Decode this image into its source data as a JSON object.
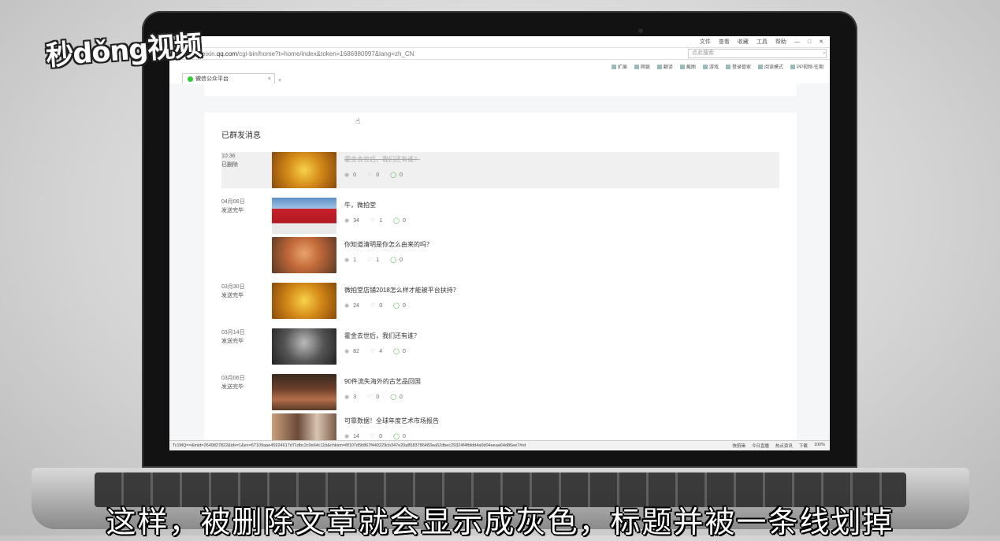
{
  "watermark": "秒dǒng视频",
  "subtitle": "这样，被删除文章就会显示成灰色，标题并被一条线划掉",
  "browser": {
    "menu": [
      "文件",
      "查看",
      "收藏",
      "工具",
      "帮助"
    ],
    "url_prefix": "mp.weixin.",
    "url_domain": "qq.com",
    "url_rest": "/cgi-bin/home?t=home/index&token=1686980997&lang=zh_CN",
    "search_placeholder": "点此搜索",
    "toolbar": [
      "扩展",
      "网银",
      "翻译",
      "截图",
      "游戏",
      "登录管家",
      "阅读模式",
      "PP视频-往期"
    ],
    "tab_title": "微信公众平台",
    "status_url": "Tc1MQ==&mid=2649827822&idx=1&sn=67109aae45924617d71dbc2c0e64c11b&chksm=8f107d5b867f440229cb347e20a8583786483ea52dbec29324f4fbfdd4a0d04eeaa64d86ee7#rd",
    "status_right": [
      "快剪辑",
      "今日直播",
      "热点资讯",
      "下载",
      "100%"
    ]
  },
  "panel": {
    "heading": "已群发消息",
    "rows": [
      {
        "time": "10:36",
        "status": "已删除",
        "title": "霍金去世后，我们还有谁？",
        "views": "0",
        "likes": "0",
        "comments": "0",
        "deleted": true
      },
      {
        "time": "04月06日",
        "status": "发送完毕",
        "title": "牛，微拍堂",
        "views": "34",
        "likes": "1",
        "comments": "0"
      },
      {
        "time": "",
        "status": "",
        "title": "你知道清明是你怎么由来的吗？",
        "views": "1",
        "likes": "1",
        "comments": "0"
      },
      {
        "time": "03月30日",
        "status": "发送完毕",
        "title": "微拍堂店铺2018怎么样才能被平台扶持？",
        "views": "24",
        "likes": "0",
        "comments": "0"
      },
      {
        "time": "03月14日",
        "status": "发送完毕",
        "title": "霍金去世后，我们还有谁？",
        "views": "82",
        "likes": "4",
        "comments": "0"
      },
      {
        "time": "03月06日",
        "status": "发送完毕",
        "title": "90件流失海外的古艺品回国",
        "views": "3",
        "likes": "0",
        "comments": "0"
      },
      {
        "time": "",
        "status": "",
        "title": "可靠数据！全球年度艺术市场报告",
        "views": "14",
        "likes": "0",
        "comments": "0"
      }
    ]
  }
}
